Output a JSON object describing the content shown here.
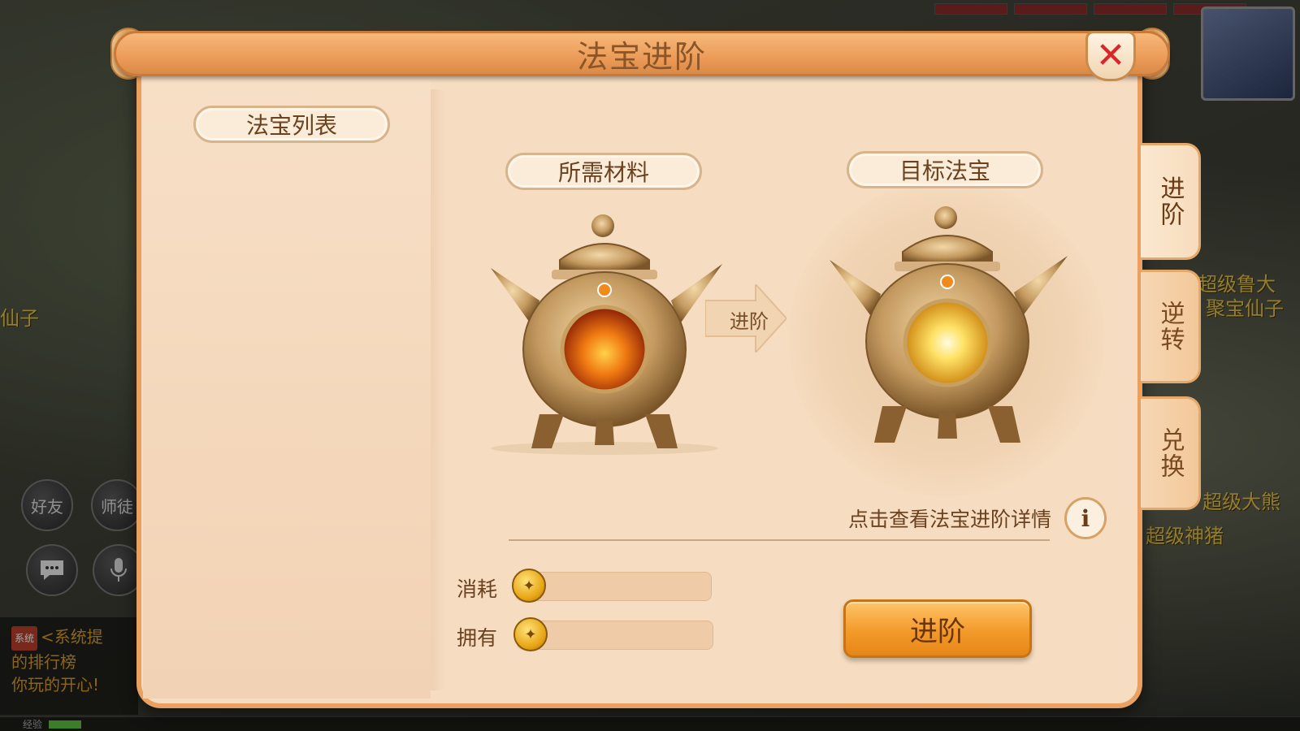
{
  "window": {
    "title": "法宝进阶",
    "close_glyph": "✕"
  },
  "left_panel": {
    "header": "法宝列表"
  },
  "main": {
    "required_label": "所需材料",
    "target_label": "目标法宝",
    "arrow_label": "进阶",
    "details_link": "点击查看法宝进阶详情",
    "info_glyph": "i",
    "consume_label": "消耗",
    "own_label": "拥有",
    "consume_value": "",
    "own_value": "",
    "advance_button": "进阶"
  },
  "side_tabs": [
    {
      "label": "进阶",
      "active": true
    },
    {
      "label": "逆转",
      "active": false
    },
    {
      "label": "兑换",
      "active": false
    }
  ],
  "background": {
    "friends_label": "好友",
    "master_label": "师徒",
    "chat_system_tag": "系统",
    "chat_lines": [
      "<系统提",
      "的排行榜",
      "你玩的开心!"
    ],
    "world_labels": [
      "仙子",
      "超级鲁大",
      "聚宝仙子",
      "超级大熊",
      "超级神猪"
    ],
    "exp_label": "经验"
  },
  "colors": {
    "panel_bg": "#f6dcc0",
    "title_bar": "#ec9c58",
    "close_x": "#d8262a",
    "button": "#f39a2a",
    "text_brown": "#6a4220"
  },
  "icons": {
    "close": "close-icon",
    "info": "info-icon",
    "coin": "gold-coin-icon",
    "artifact": "cauldron-artifact",
    "arrow": "arrow-right-icon"
  }
}
